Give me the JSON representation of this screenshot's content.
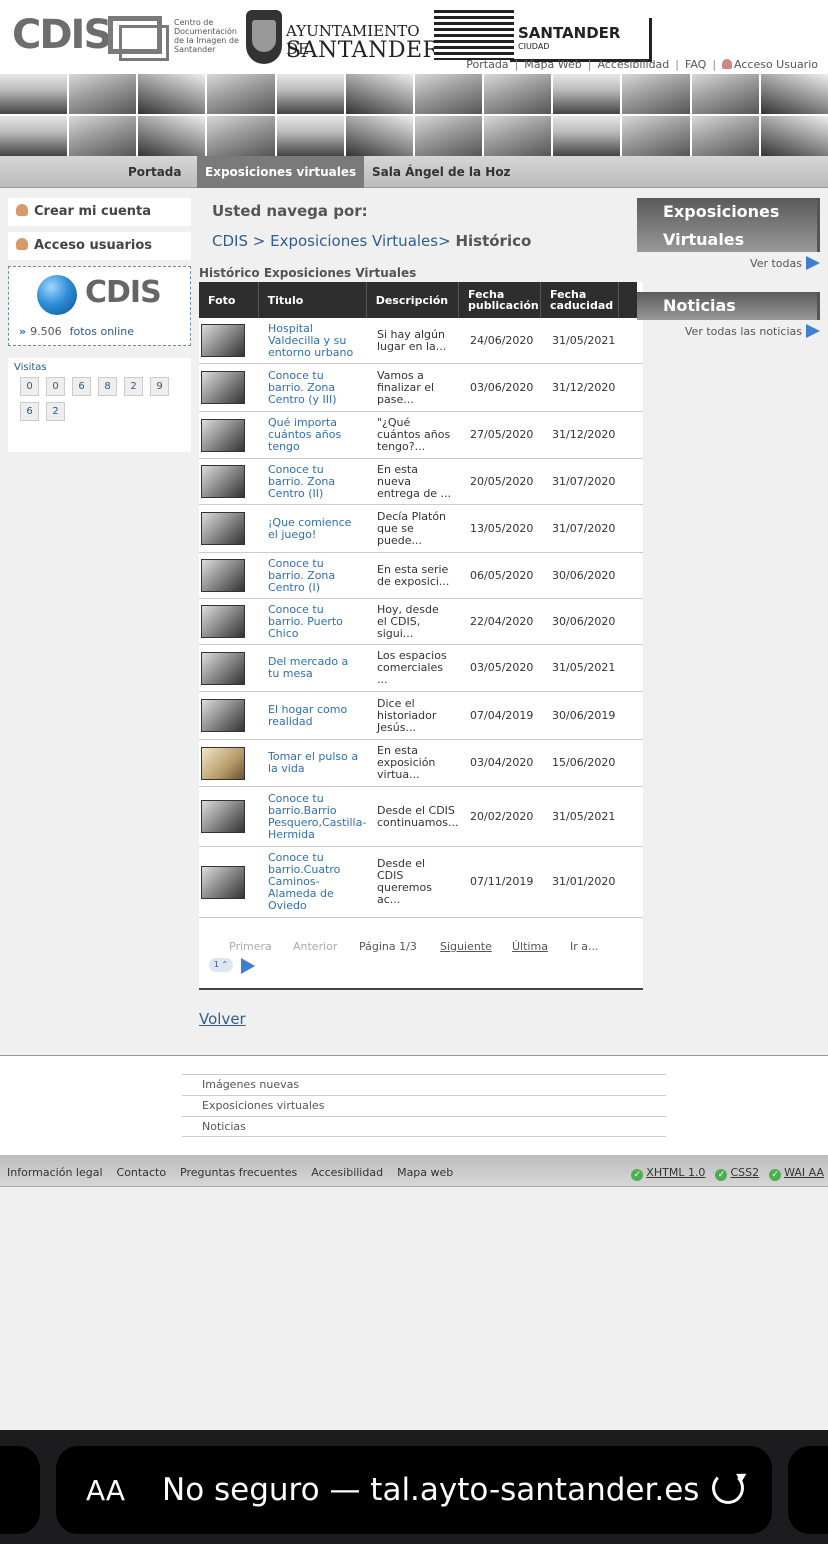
{
  "header": {
    "cdis_word": "CDIS",
    "cdis_sub": "Centro de Documentación de la Imagen de Santander",
    "ayto_line1": "AYUNTAMIENTO DE",
    "ayto_line2": "SANTANDER",
    "stc_title": "SANTANDER",
    "stc_sub": "CIUDAD",
    "top_links": [
      "Portada",
      "Mapa Web",
      "Accesibilidad",
      "FAQ",
      "Acceso Usuario"
    ]
  },
  "nav": {
    "items": [
      "Portada",
      "Exposiciones virtuales",
      "Sala Ángel de la Hoz"
    ],
    "active": "Exposiciones virtuales"
  },
  "sidebar": {
    "create_account": "Crear mi cuenta",
    "user_access": "Acceso usuarios",
    "cdis_word": "CDIS",
    "photo_count": "9.506",
    "photos_online": "fotos online",
    "visits_label": "Visitas",
    "visit_digits": [
      "0",
      "0",
      "6",
      "8",
      "2",
      "9",
      "6",
      "2"
    ]
  },
  "main": {
    "browse_label": "Usted navega por:",
    "breadcrumb": [
      "CDIS >",
      "Exposiciones Virtuales>",
      "Histórico"
    ],
    "table_title": "Histórico Exposiciones Virtuales",
    "columns": [
      "Foto",
      "Titulo",
      "Descripción",
      "Fecha publicación",
      "Fecha caducidad"
    ],
    "rows": [
      {
        "title": "Hospital Valdecilla y su entorno urbano",
        "desc": "Si hay algún lugar en la...",
        "pub": "24/06/2020",
        "exp": "31/05/2021"
      },
      {
        "title": "Conoce tu barrio. Zona Centro (y III)",
        "desc": "Vamos a finalizar el pase...",
        "pub": "03/06/2020",
        "exp": "31/12/2020"
      },
      {
        "title": "Qué importa cuántos años tengo",
        "desc": "\"¿Qué cuántos años tengo?...",
        "pub": "27/05/2020",
        "exp": "31/12/2020"
      },
      {
        "title": "Conoce tu barrio. Zona Centro (II)",
        "desc": "En esta nueva entrega de ...",
        "pub": "20/05/2020",
        "exp": "31/07/2020"
      },
      {
        "title": "¡Que comience el juego!",
        "desc": "Decía Platón que se puede...",
        "pub": "13/05/2020",
        "exp": "31/07/2020"
      },
      {
        "title": "Conoce tu barrio. Zona Centro (I)",
        "desc": "En esta serie de exposici...",
        "pub": "06/05/2020",
        "exp": "30/06/2020"
      },
      {
        "title": "Conoce tu barrio. Puerto Chico",
        "desc": "Hoy, desde el CDIS, sigui...",
        "pub": "22/04/2020",
        "exp": "30/06/2020"
      },
      {
        "title": "Del mercado a tu mesa",
        "desc": "Los espacios comerciales ...",
        "pub": "03/05/2020",
        "exp": "31/05/2021"
      },
      {
        "title": "El hogar como realidad",
        "desc": "Dice el historiador Jesús...",
        "pub": "07/04/2019",
        "exp": "30/06/2019"
      },
      {
        "title": "Tomar el pulso a la vida",
        "desc": "En esta exposición virtua...",
        "pub": "03/04/2020",
        "exp": "15/06/2020"
      },
      {
        "title": "Conoce tu barrio.Barrio Pesquero,Castilla-Hermida",
        "desc": "Desde el CDIS continuamos...",
        "pub": "20/02/2020",
        "exp": "31/05/2021"
      },
      {
        "title": "Conoce tu barrio.Cuatro Caminos-Alameda de Oviedo",
        "desc": "Desde el CDIS queremos ac...",
        "pub": "07/11/2019",
        "exp": "31/01/2020"
      }
    ],
    "pager": {
      "first": "Primera",
      "prev": "Anterior",
      "page": "Página 1/3",
      "next": "Siguiente",
      "last": "Última",
      "goto": "Ir a...",
      "select_value": "1"
    },
    "back": "Volver"
  },
  "right": {
    "expos_title": "Exposiciones Virtuales",
    "see_all": "Ver todas",
    "news_title": "Noticias",
    "see_all_news": "Ver todas las noticias"
  },
  "footer": {
    "links": [
      "Imágenes nuevas",
      "Exposiciones virtuales",
      "Noticias"
    ],
    "bottom_links": [
      "Información legal",
      "Contacto",
      "Preguntas frecuentes",
      "Accesibilidad",
      "Mapa web"
    ],
    "validators": [
      "XHTML 1.0",
      "CSS2",
      "WAI AA"
    ]
  },
  "browser": {
    "aa": "AA",
    "url": "No seguro — tal.ayto-santander.es"
  },
  "colors": {
    "nav_active": "#7a7a7a",
    "table_header": "#2e2e2e",
    "link": "#2f6fb0",
    "accent_blue": "#3f7fd0"
  }
}
